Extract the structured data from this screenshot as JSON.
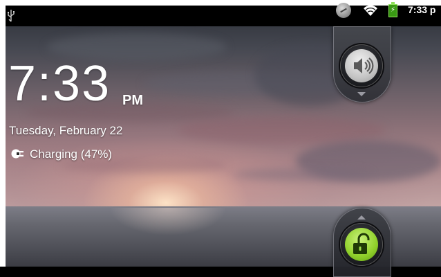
{
  "status_bar": {
    "time": "7:33 p",
    "icons": [
      "usb-icon",
      "sync-icon",
      "wifi-icon",
      "battery-charging-icon"
    ]
  },
  "lock_screen": {
    "time": "7:33",
    "ampm": "PM",
    "date": "Tuesday, February 22",
    "charging_text": "Charging (47%)",
    "battery_percent": 47
  },
  "controls": {
    "sound_toggle_icon": "speaker-icon",
    "unlock_icon": "unlock-icon"
  },
  "colors": {
    "unlock_accent": "#8fcf2a",
    "battery_green": "#3a9a14"
  }
}
